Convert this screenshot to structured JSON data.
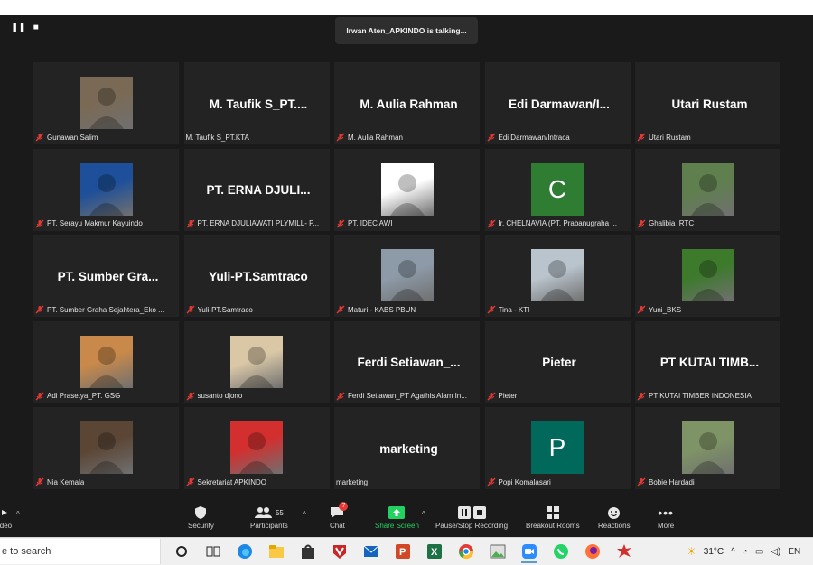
{
  "window": {
    "talking_banner": "Irwan Aten_APKINDO is talking..."
  },
  "tiles": [
    {
      "title": "",
      "label": "Gunawan Salim",
      "avatar": "photo",
      "color": "#7a6a55",
      "muted": true
    },
    {
      "title": "M. Taufik S_PT....",
      "label": "M. Taufik S_PT.KTA",
      "avatar": "",
      "color": "",
      "muted": false
    },
    {
      "title": "M. Aulia Rahman",
      "label": "M. Aulia Rahman",
      "avatar": "",
      "color": "",
      "muted": true
    },
    {
      "title": "Edi  Darmawan/I...",
      "label": "Edi Darmawan/Intraca",
      "avatar": "",
      "color": "",
      "muted": true
    },
    {
      "title": "Utari Rustam",
      "label": "Utari Rustam",
      "avatar": "",
      "color": "",
      "muted": true
    },
    {
      "title": "",
      "label": "PT. Serayu Makmur Kayuindo",
      "avatar": "photo",
      "color": "#1d4f9a",
      "muted": true
    },
    {
      "title": "PT. ERNA  DJULI...",
      "label": "PT. ERNA DJULIAWATI PLYMILL- P...",
      "avatar": "",
      "color": "",
      "muted": true
    },
    {
      "title": "",
      "label": "PT. IDEC AWI",
      "avatar": "photo",
      "color": "#ffffff",
      "muted": true
    },
    {
      "title": "",
      "label": "Ir. CHELNAVIA (PT. Prabanugraha ...",
      "avatar": "C",
      "color": "#2e7d32",
      "muted": true
    },
    {
      "title": "",
      "label": "Ghalibia_RTC",
      "avatar": "photo",
      "color": "#5f7f4e",
      "muted": true
    },
    {
      "title": "PT. Sumber Gra...",
      "label": "PT. Sumber Graha Sejahtera_Eko ...",
      "avatar": "",
      "color": "",
      "muted": true
    },
    {
      "title": "Yuli-PT.Samtraco",
      "label": "Yuli-PT.Samtraco",
      "avatar": "",
      "color": "",
      "muted": true
    },
    {
      "title": "",
      "label": "Maturi - KABS PBUN",
      "avatar": "photo",
      "color": "#8d9aa8",
      "muted": true
    },
    {
      "title": "",
      "label": "Tina - KTI",
      "avatar": "photo",
      "color": "#b9c4cc",
      "muted": true
    },
    {
      "title": "",
      "label": "Yuni_BKS",
      "avatar": "photo",
      "color": "#3d7a2c",
      "muted": true
    },
    {
      "title": "",
      "label": "Adi Prasetya_PT. GSG",
      "avatar": "photo",
      "color": "#c8894a",
      "muted": true
    },
    {
      "title": "",
      "label": "susanto djono",
      "avatar": "photo",
      "color": "#d9c7a6",
      "muted": true
    },
    {
      "title": "Ferdi  Setiawan_...",
      "label": "Ferdi Setiawan_PT Agathis Alam In...",
      "avatar": "",
      "color": "",
      "muted": true
    },
    {
      "title": "Pieter",
      "label": "Pieter",
      "avatar": "",
      "color": "",
      "muted": true
    },
    {
      "title": "PT  KUTAI  TIMB...",
      "label": "PT KUTAI TIMBER INDONESIA",
      "avatar": "",
      "color": "",
      "muted": true
    },
    {
      "title": "",
      "label": "Nia Kemala",
      "avatar": "photo",
      "color": "#5b4636",
      "muted": true
    },
    {
      "title": "",
      "label": "Sekretariat APKINDO",
      "avatar": "photo",
      "color": "#d32f2f",
      "muted": true
    },
    {
      "title": "marketing",
      "label": "marketing",
      "avatar": "",
      "color": "",
      "muted": false
    },
    {
      "title": "",
      "label": "Popi Komalasari",
      "avatar": "P",
      "color": "#00695c",
      "muted": true
    },
    {
      "title": "",
      "label": "Bobie Hardadi",
      "avatar": "photo",
      "color": "#7f9466",
      "muted": true
    }
  ],
  "toolbar": {
    "video_label": "ideo",
    "security_label": "Security",
    "participants_label": "Participants",
    "participants_count": "55",
    "chat_label": "Chat",
    "chat_badge": "7",
    "share_label": "Share Screen",
    "record_label": "Pause/Stop Recording",
    "breakout_label": "Breakout Rooms",
    "reactions_label": "Reactions",
    "more_label": "More"
  },
  "taskbar": {
    "search_text": "e to search",
    "temperature": "31°C",
    "lang": "EN"
  }
}
